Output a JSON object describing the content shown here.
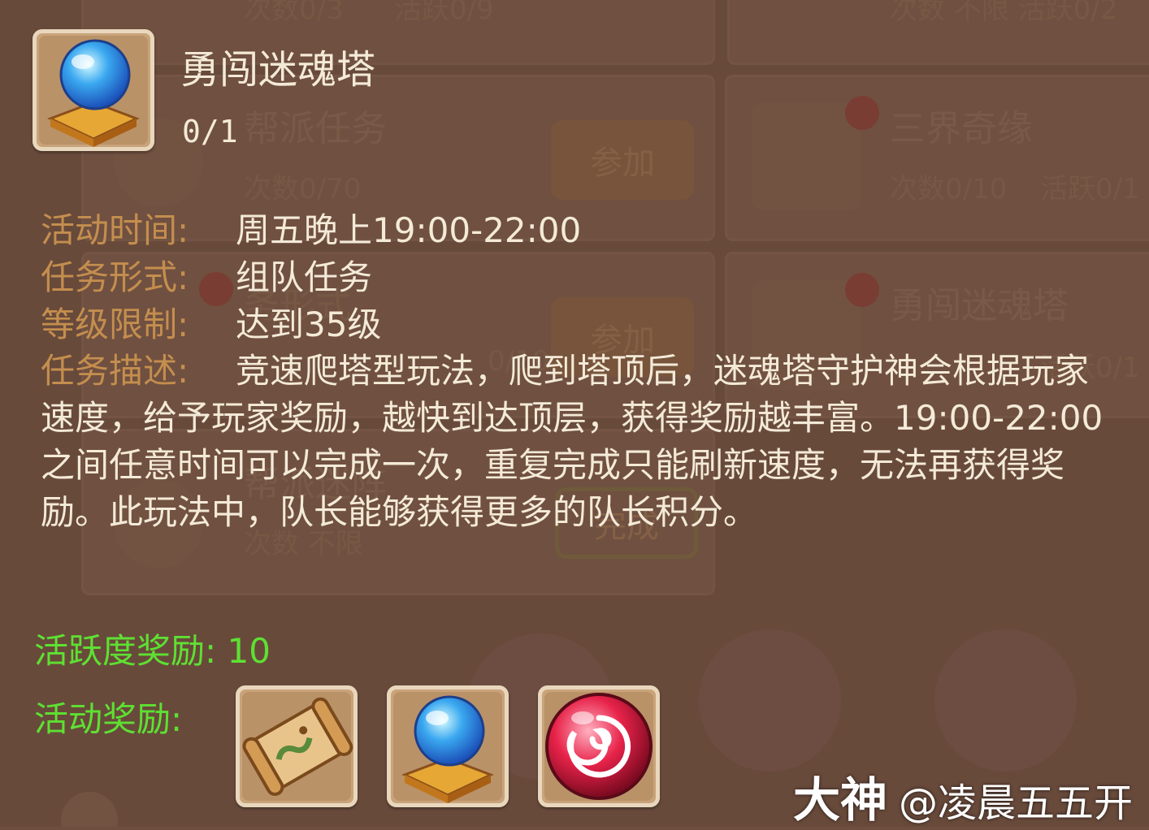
{
  "background": {
    "list_items": [
      {
        "name": "帮派任务",
        "count": "次数0/70",
        "button": "参加"
      },
      {
        "name": "三界奇缘",
        "count": "次数0/10",
        "activity": "活跃0/1"
      },
      {
        "name": "勇闯迷魂塔",
        "count": "",
        "activity": "活跃0/1"
      }
    ],
    "top_fragment_left": "次数0/3",
    "top_fragment_mid": "活跃0/9",
    "top_fragment_right": "次数 不限  活跃0/2",
    "row3_mid_label": "参加",
    "row3_fragment": "0/10",
    "row3_left_label": "务形式",
    "row4_left_label": "帮派迷阵",
    "row4_count": "次数 不限",
    "row4_button": "完成"
  },
  "panel": {
    "title": "勇闯迷魂塔",
    "progress": "0/1",
    "fields": [
      {
        "label": "活动时间:",
        "value": "周五晚上19:00-22:00"
      },
      {
        "label": "任务形式:",
        "value": "组队任务"
      },
      {
        "label": "等级限制:",
        "value": "达到35级"
      }
    ],
    "description_label": "任务描述:",
    "description": "竞速爬塔型玩法，爬到塔顶后，迷魂塔守护神会根据玩家速度，给予玩家奖励，越快到达顶层，获得奖励越丰富。19:00-22:00之间任意时间可以完成一次，重复完成只能刷新速度，无法再获得奖励。此玩法中，队长能够获得更多的队长积分。",
    "activity_reward_label": "活跃度奖励:",
    "activity_reward_value": "10",
    "rewards_label": "活动奖励:",
    "reward_icons": [
      "treasure-map-icon",
      "crystal-ball-icon",
      "red-orb-icon"
    ]
  },
  "watermark": {
    "brand": "大神",
    "user": "@凌晨五五开"
  },
  "colors": {
    "label": "#c48e4e",
    "value": "#f4ead8",
    "green": "#5ee032",
    "panel_bg": "#6e4f3f"
  }
}
